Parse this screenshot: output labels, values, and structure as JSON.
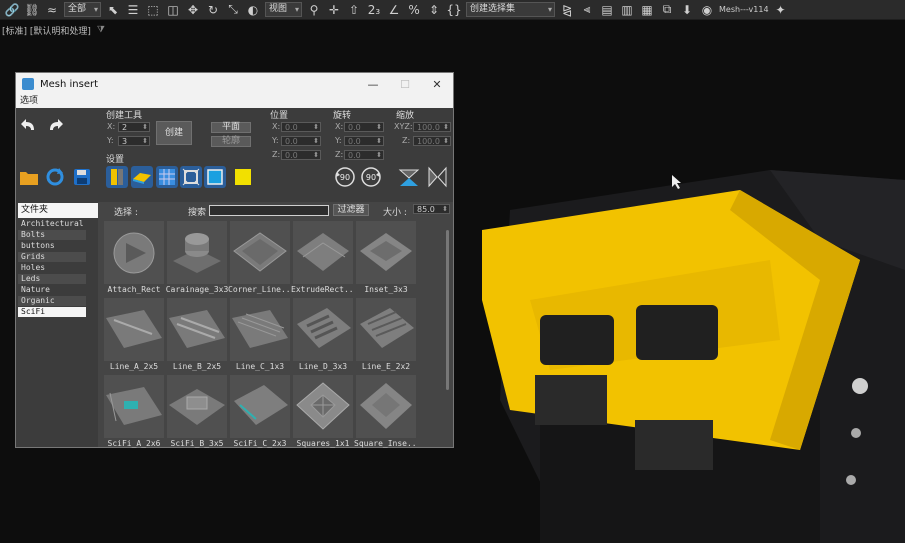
{
  "toolbar": {
    "filter_select": "全部",
    "view_select": "视图",
    "selection_set": "创建选择集",
    "user_label": "Mesh---v114"
  },
  "subbar": {
    "text": "[标准] [默认明和处理]"
  },
  "window": {
    "title": "Mesh insert",
    "menu": "选项"
  },
  "create": {
    "section": "创建工具",
    "x_label": "X:",
    "x_value": "2",
    "y_label": "Y:",
    "y_value": "3",
    "create_button": "创建",
    "plane_button": "平面",
    "line_button": "轮廓"
  },
  "position": {
    "section": "位置",
    "x_label": "X:",
    "x_value": "0.0",
    "y_label": "Y:",
    "y_value": "0.0",
    "z_label": "Z:",
    "z_value": "0.0"
  },
  "rotation": {
    "section": "旋转",
    "x_label": "X:",
    "x_value": "0.0",
    "y_label": "Y:",
    "y_value": "0.0",
    "z_label": "Z:",
    "z_value": "0.0"
  },
  "scale": {
    "section": "缩放",
    "xyz_label": "XYZ:",
    "xyz_value": "100.0",
    "z_label": "Z:",
    "z_value": "100.0"
  },
  "settings": {
    "section": "设置",
    "rot_ccw": "90",
    "rot_cw": "90"
  },
  "browser": {
    "select_label": "选择 :",
    "search_label": "搜索 :",
    "search_value": "",
    "filter_button": "过滤器",
    "size_label": "大小 :",
    "size_value": "85.0"
  },
  "folders": {
    "title": "文件夹",
    "items": [
      "Architectural",
      "Bolts",
      "buttons",
      "Grids",
      "Holes",
      "Leds",
      "Nature",
      "Organic",
      "SciFi"
    ],
    "selected": "SciFi"
  },
  "meshes": [
    "Attach_Rect",
    "Carainage_3x3",
    "Corner_Line...",
    "ExtrudeRect...",
    "Inset_3x3",
    "Line_A_2x5",
    "Line_B_2x5",
    "Line_C_1x3",
    "Line_D_3x3",
    "Line_E_2x2",
    "SciFi_A_2x6",
    "SciFi_B_3x5",
    "SciFi_C_2x3",
    "Squares_1x1",
    "Square_Inse..."
  ],
  "colors": {
    "accent": "#f2c200",
    "window_bg": "#454545",
    "panel_bg": "#3c3c3c"
  }
}
